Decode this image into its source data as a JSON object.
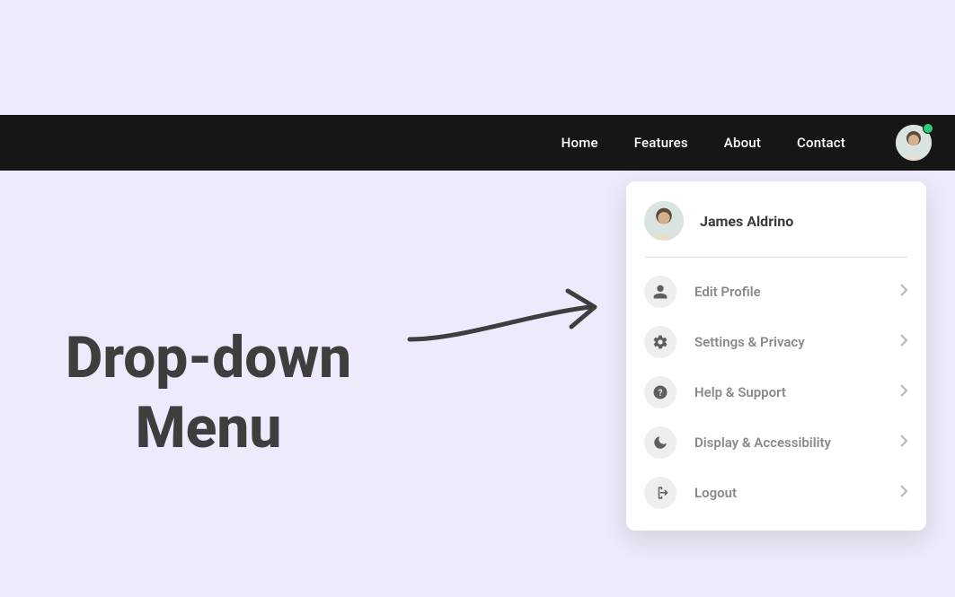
{
  "nav": {
    "items": [
      {
        "label": "Home"
      },
      {
        "label": "Features"
      },
      {
        "label": "About"
      },
      {
        "label": "Contact"
      }
    ]
  },
  "user": {
    "name": "James Aldrino"
  },
  "dropdown": {
    "items": [
      {
        "icon": "person",
        "label": "Edit Profile"
      },
      {
        "icon": "gear",
        "label": "Settings & Privacy"
      },
      {
        "icon": "help",
        "label": "Help & Support"
      },
      {
        "icon": "moon",
        "label": "Display & Accessibility"
      },
      {
        "icon": "logout",
        "label": "Logout"
      }
    ]
  },
  "page": {
    "heading_line1": "Drop-down",
    "heading_line2": "Menu"
  }
}
